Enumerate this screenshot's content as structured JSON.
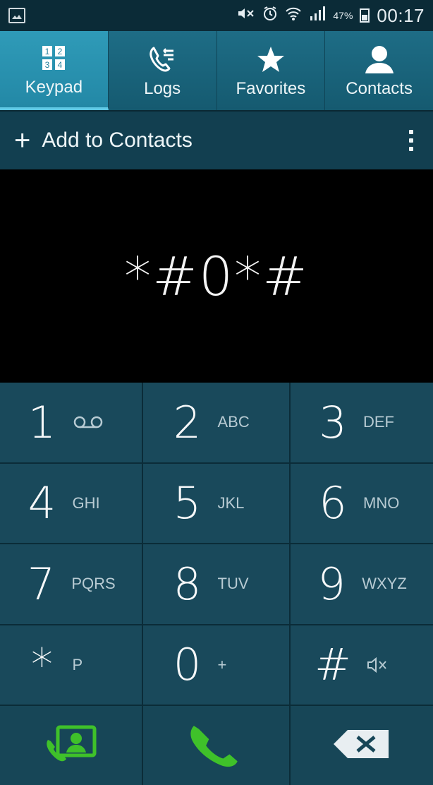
{
  "status_bar": {
    "battery_percent": "47%",
    "time": "00:17",
    "icons": [
      "gallery-icon",
      "mute-icon",
      "alarm-icon",
      "wifi-icon",
      "signal-icon",
      "battery-icon"
    ]
  },
  "tabs": [
    {
      "label": "Keypad",
      "icon": "keypad-icon",
      "active": true
    },
    {
      "label": "Logs",
      "icon": "logs-icon",
      "active": false
    },
    {
      "label": "Favorites",
      "icon": "star-icon",
      "active": false
    },
    {
      "label": "Contacts",
      "icon": "person-icon",
      "active": false
    }
  ],
  "action_bar": {
    "add_label": "Add to Contacts",
    "plus": "+"
  },
  "display": {
    "dialed": "*#0*#"
  },
  "keys": [
    {
      "digit": "1",
      "letters": ""
    },
    {
      "digit": "2",
      "letters": "ABC"
    },
    {
      "digit": "3",
      "letters": "DEF"
    },
    {
      "digit": "4",
      "letters": "GHI"
    },
    {
      "digit": "5",
      "letters": "JKL"
    },
    {
      "digit": "6",
      "letters": "MNO"
    },
    {
      "digit": "7",
      "letters": "PQRS"
    },
    {
      "digit": "8",
      "letters": "TUV"
    },
    {
      "digit": "9",
      "letters": "WXYZ"
    },
    {
      "digit": "*",
      "letters": "P"
    },
    {
      "digit": "0",
      "letters": "+"
    },
    {
      "digit": "#",
      "letters": ""
    }
  ],
  "colors": {
    "accent_green": "#3fc12a",
    "tab_active": "#2388a6",
    "key_bg": "#19495b"
  }
}
